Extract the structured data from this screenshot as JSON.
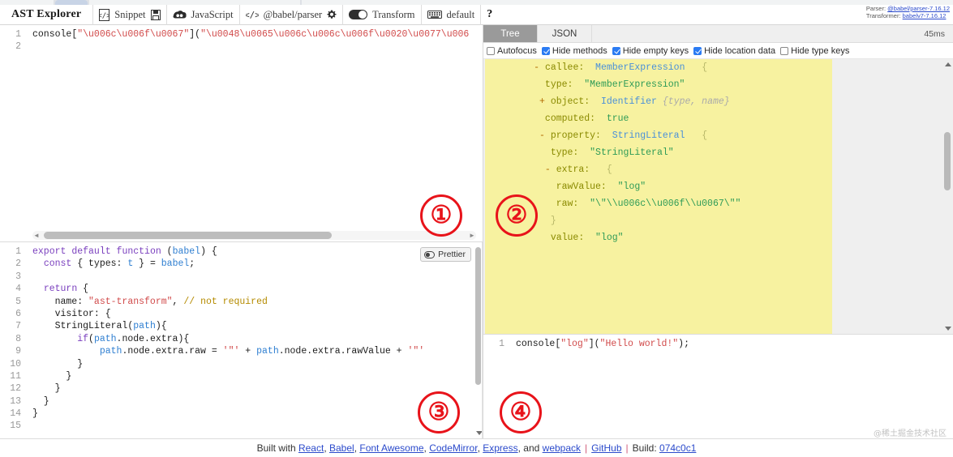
{
  "app": {
    "brand": "AST Explorer",
    "watermark": "@稀土掘金技术社区"
  },
  "toolbar": {
    "snippet_label": "Snippet",
    "snippet_icon": "code-file-icon",
    "save_icon": "floppy-save-icon",
    "language_label": "JavaScript",
    "language_icon": "js-cloud-icon",
    "parser_icon": "angle-brackets-icon",
    "parser_label": "@babel/parser",
    "settings_icon": "gear-icon",
    "transform_toggle_icon": "toggle-on-icon",
    "transform_label": "Transform",
    "keymap_icon": "keyboard-icon",
    "keymap_label": "default",
    "help_label": "?"
  },
  "versions": {
    "parser_prefix": "Parser:",
    "parser_value": "@babel/parser-7.16.12",
    "transformer_prefix": "Transformer:",
    "transformer_value": "babelv7-7.16.12"
  },
  "source_editor": {
    "name": "source-code-editor",
    "lines": [
      {
        "num": "1",
        "tokens": [
          {
            "t": "console",
            "c": "tok-plain"
          },
          {
            "t": "[",
            "c": "tok-plain"
          },
          {
            "t": "\"\\u006c\\u006f\\u0067\"",
            "c": "tok-str"
          },
          {
            "t": "](",
            "c": "tok-plain"
          },
          {
            "t": "\"\\u0048\\u0065\\u006c\\u006c\\u006f\\u0020\\u0077\\u006",
            "c": "tok-str"
          }
        ]
      },
      {
        "num": "2",
        "tokens": []
      }
    ],
    "hscroll": "horizontal-scrollbar"
  },
  "transform_editor": {
    "name": "transform-code-editor",
    "prettier_label": "Prettier",
    "prettier_icon": "prettier-toggle-icon",
    "lines": [
      {
        "num": "1",
        "tokens": [
          {
            "t": "export",
            "c": "tok-kw"
          },
          {
            "t": " ",
            "c": "tok-plain"
          },
          {
            "t": "default",
            "c": "tok-kw"
          },
          {
            "t": " ",
            "c": "tok-plain"
          },
          {
            "t": "function",
            "c": "tok-kw"
          },
          {
            "t": " (",
            "c": "tok-plain"
          },
          {
            "t": "babel",
            "c": "tok-var"
          },
          {
            "t": ") {",
            "c": "tok-plain"
          }
        ]
      },
      {
        "num": "2",
        "tokens": [
          {
            "t": "  ",
            "c": "tok-plain"
          },
          {
            "t": "const",
            "c": "tok-kw"
          },
          {
            "t": " { types: ",
            "c": "tok-plain"
          },
          {
            "t": "t",
            "c": "tok-var"
          },
          {
            "t": " } = ",
            "c": "tok-plain"
          },
          {
            "t": "babel",
            "c": "tok-var"
          },
          {
            "t": ";",
            "c": "tok-plain"
          }
        ]
      },
      {
        "num": "3",
        "tokens": []
      },
      {
        "num": "4",
        "tokens": [
          {
            "t": "  ",
            "c": "tok-plain"
          },
          {
            "t": "return",
            "c": "tok-kw"
          },
          {
            "t": " {",
            "c": "tok-plain"
          }
        ]
      },
      {
        "num": "5",
        "tokens": [
          {
            "t": "    name: ",
            "c": "tok-plain"
          },
          {
            "t": "\"ast-transform\"",
            "c": "tok-str"
          },
          {
            "t": ", ",
            "c": "tok-plain"
          },
          {
            "t": "// not required",
            "c": "tok-com"
          }
        ]
      },
      {
        "num": "6",
        "tokens": [
          {
            "t": "    visitor: {",
            "c": "tok-plain"
          }
        ]
      },
      {
        "num": "7",
        "tokens": [
          {
            "t": "    StringLiteral(",
            "c": "tok-plain"
          },
          {
            "t": "path",
            "c": "tok-var"
          },
          {
            "t": "){",
            "c": "tok-plain"
          }
        ]
      },
      {
        "num": "8",
        "tokens": [
          {
            "t": "        ",
            "c": "tok-plain"
          },
          {
            "t": "if",
            "c": "tok-kw"
          },
          {
            "t": "(",
            "c": "tok-plain"
          },
          {
            "t": "path",
            "c": "tok-var"
          },
          {
            "t": ".node.extra){",
            "c": "tok-plain"
          }
        ]
      },
      {
        "num": "9",
        "tokens": [
          {
            "t": "            ",
            "c": "tok-plain"
          },
          {
            "t": "path",
            "c": "tok-var"
          },
          {
            "t": ".node.extra.raw = ",
            "c": "tok-plain"
          },
          {
            "t": "'\"'",
            "c": "tok-str"
          },
          {
            "t": " + ",
            "c": "tok-plain"
          },
          {
            "t": "path",
            "c": "tok-var"
          },
          {
            "t": ".node.extra.rawValue + ",
            "c": "tok-plain"
          },
          {
            "t": "'\"'",
            "c": "tok-str"
          }
        ]
      },
      {
        "num": "10",
        "tokens": [
          {
            "t": "        }",
            "c": "tok-plain"
          }
        ]
      },
      {
        "num": "11",
        "tokens": [
          {
            "t": "      }",
            "c": "tok-plain"
          }
        ]
      },
      {
        "num": "12",
        "tokens": [
          {
            "t": "    }",
            "c": "tok-plain"
          }
        ]
      },
      {
        "num": "13",
        "tokens": [
          {
            "t": "  }",
            "c": "tok-plain"
          }
        ]
      },
      {
        "num": "14",
        "tokens": [
          {
            "t": "}",
            "c": "tok-plain"
          }
        ]
      },
      {
        "num": "15",
        "tokens": []
      }
    ]
  },
  "output_editor": {
    "name": "transform-output",
    "lines": [
      {
        "num": "1",
        "tokens": [
          {
            "t": "console",
            "c": "tok-plain"
          },
          {
            "t": "[",
            "c": "tok-plain"
          },
          {
            "t": "\"log\"",
            "c": "tok-str"
          },
          {
            "t": "](",
            "c": "tok-plain"
          },
          {
            "t": "\"Hello world!\"",
            "c": "tok-str"
          },
          {
            "t": ");",
            "c": "tok-plain"
          }
        ]
      }
    ]
  },
  "tree_panel": {
    "tabs": [
      {
        "label": "Tree",
        "active": true
      },
      {
        "label": "JSON",
        "active": false
      }
    ],
    "parse_time": "45ms",
    "options": [
      {
        "label": "Autofocus",
        "checked": false
      },
      {
        "label": "Hide methods",
        "checked": true
      },
      {
        "label": "Hide empty keys",
        "checked": true
      },
      {
        "label": "Hide location data",
        "checked": true
      },
      {
        "label": "Hide type keys",
        "checked": false
      }
    ],
    "rows": [
      {
        "indent": 9,
        "toggle": "-",
        "key": "callee:",
        "type": "MemberExpression",
        "brace": "{"
      },
      {
        "indent": 11,
        "toggle": "",
        "key": "type:",
        "str": "\"MemberExpression\""
      },
      {
        "indent": 10,
        "toggle": "+",
        "key": "object:",
        "type": "Identifier",
        "ghost": "{type, name}"
      },
      {
        "indent": 11,
        "toggle": "",
        "key": "computed:",
        "bool": "true"
      },
      {
        "indent": 10,
        "toggle": "-",
        "key": "property:",
        "type": "StringLiteral",
        "brace": "{"
      },
      {
        "indent": 12,
        "toggle": "",
        "key": "type:",
        "str": "\"StringLiteral\""
      },
      {
        "indent": 11,
        "toggle": "-",
        "key": "extra:",
        "brace": "{"
      },
      {
        "indent": 13,
        "toggle": "",
        "key": "rawValue:",
        "str": "\"log\""
      },
      {
        "indent": 13,
        "toggle": "",
        "key": "raw:",
        "str": "\"\\\"\\\\u006c\\\\u006f\\\\u0067\\\"\""
      },
      {
        "indent": 12,
        "toggle": "",
        "key": "}",
        "closeonly": true
      },
      {
        "indent": 12,
        "toggle": "",
        "key": "value:",
        "str": "\"log\""
      }
    ]
  },
  "footer": {
    "built_with": "Built with",
    "links": [
      "React",
      "Babel",
      "Font Awesome",
      "CodeMirror",
      "Express"
    ],
    "and": "and",
    "webpack": "webpack",
    "github": "GitHub",
    "build_label": "Build:",
    "build_hash": "074c0c1"
  },
  "annotations": [
    {
      "id": "1",
      "glyph": "①"
    },
    {
      "id": "2",
      "glyph": "②"
    },
    {
      "id": "3",
      "glyph": "③"
    },
    {
      "id": "4",
      "glyph": "④"
    }
  ]
}
